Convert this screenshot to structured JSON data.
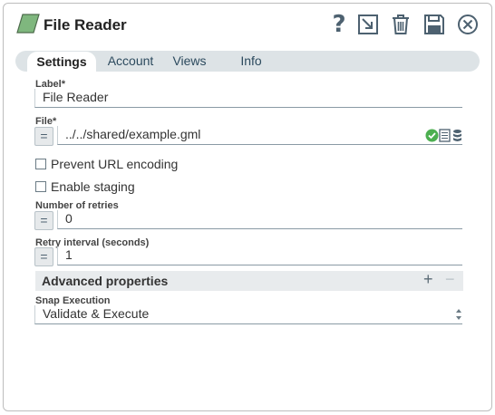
{
  "header": {
    "title": "File Reader",
    "icons": [
      "help-icon",
      "export-icon",
      "trash-icon",
      "save-icon",
      "close-icon"
    ],
    "help_glyph": "?"
  },
  "tabs": [
    {
      "label": "Settings",
      "active": true
    },
    {
      "label": "Account"
    },
    {
      "label": "Views"
    },
    {
      "label": "Info"
    }
  ],
  "form": {
    "label": {
      "caption": "Label*",
      "value": "File Reader"
    },
    "file": {
      "caption": "File*",
      "value": "../../shared/example.gml",
      "eq_glyph": "="
    },
    "prevent_url_encoding": {
      "label": "Prevent URL encoding",
      "checked": false
    },
    "enable_staging": {
      "label": "Enable staging",
      "checked": false
    },
    "retries": {
      "caption": "Number of retries",
      "value": "0",
      "eq_glyph": "="
    },
    "retry_interval": {
      "caption": "Retry interval (seconds)",
      "value": "1",
      "eq_glyph": "="
    },
    "advanced": {
      "label": "Advanced properties",
      "plus": "+",
      "minus": "−"
    },
    "snap_execution": {
      "caption": "Snap Execution",
      "value": "Validate & Execute"
    }
  },
  "colors": {
    "logo_green": "#7fb77e",
    "icon": "#4d6170",
    "valid_green": "#4caf50",
    "tab_bar": "#dde3e6"
  }
}
